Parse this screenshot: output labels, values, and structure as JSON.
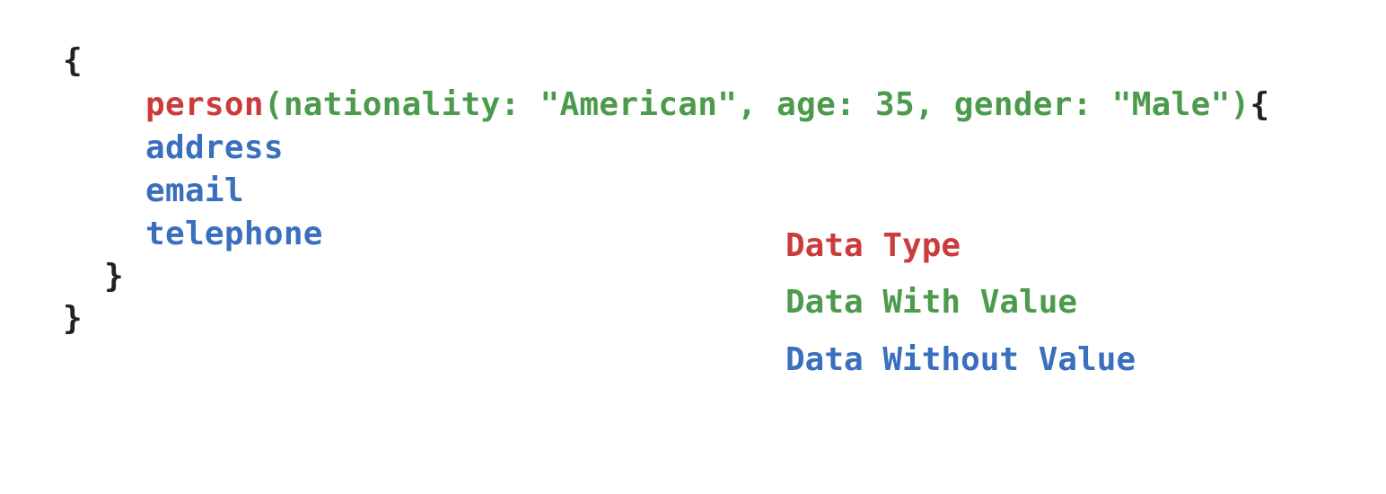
{
  "code": {
    "open_brace_outer": "{",
    "type_name": "person",
    "args": "(nationality: \"American\", age: 35, gender: \"Male\")",
    "open_brace_inner": "{",
    "fields": [
      "address",
      "email",
      "telephone"
    ],
    "close_brace_inner": "}",
    "close_brace_outer": "}"
  },
  "legend": {
    "items": [
      {
        "label": "Data Type",
        "color": "#cc3b3b"
      },
      {
        "label": "Data With Value",
        "color": "#4c9a4c"
      },
      {
        "label": "Data Without Value",
        "color": "#3a6fbd"
      }
    ]
  }
}
